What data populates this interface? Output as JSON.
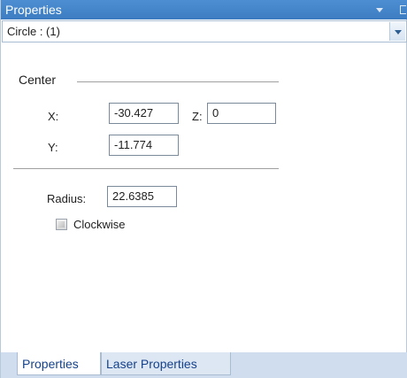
{
  "panel": {
    "title": "Properties",
    "selector_value": "Circle : (1)"
  },
  "center": {
    "label": "Center",
    "x_label": "X:",
    "x_value": "-30.427",
    "z_label": "Z:",
    "z_value": "0",
    "y_label": "Y:",
    "y_value": "-11.774"
  },
  "radius": {
    "label": "Radius:",
    "value": "22.6385"
  },
  "clockwise": {
    "label": "Clockwise",
    "checked": false,
    "enabled": false
  },
  "tabs": [
    {
      "label": "Properties",
      "active": true
    },
    {
      "label": "Laser Properties",
      "active": false
    }
  ]
}
